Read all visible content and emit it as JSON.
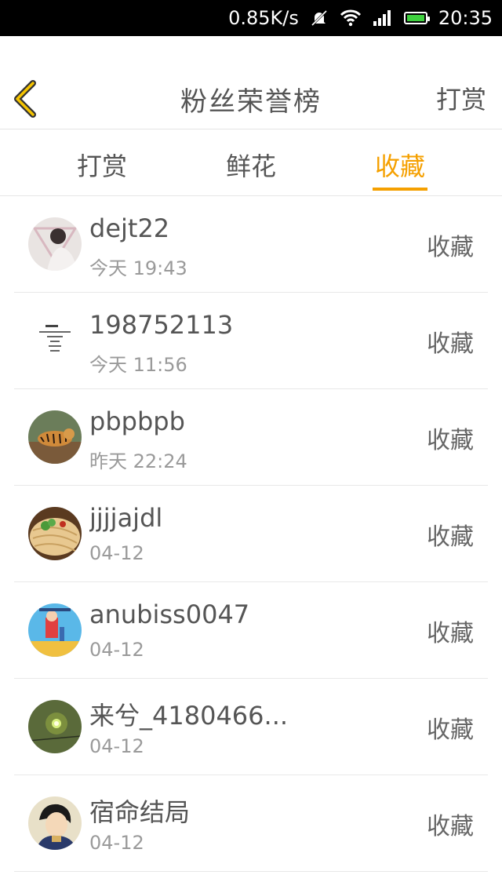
{
  "status_bar": {
    "net_speed": "0.85K/s",
    "time": "20:35",
    "icons": [
      "bell-muted-icon",
      "wifi-icon",
      "signal-icon",
      "battery-icon"
    ]
  },
  "header": {
    "title": "粉丝荣誉榜",
    "action_label": "打赏",
    "back_icon": "chevron-left-icon"
  },
  "tabs": [
    {
      "label": "打赏",
      "active": false
    },
    {
      "label": "鲜花",
      "active": false
    },
    {
      "label": "收藏",
      "active": true
    }
  ],
  "colors": {
    "accent": "#f5a000",
    "text": "#555555",
    "subtext": "#9a9a9a",
    "divider": "#e8e8e8"
  },
  "fans": [
    {
      "name": "dejt22",
      "time": "今天 19:43",
      "action": "收藏",
      "avatar": "avatar-portrait"
    },
    {
      "name": "198752113",
      "time": "今天 11:56",
      "action": "收藏",
      "avatar": "avatar-text-note"
    },
    {
      "name": "pbpbpb",
      "time": "昨天 22:24",
      "action": "收藏",
      "avatar": "avatar-tiger"
    },
    {
      "name": "jjjjajdl",
      "time": "04-12",
      "action": "收藏",
      "avatar": "avatar-noodles"
    },
    {
      "name": "anubiss0047",
      "time": "04-12",
      "action": "收藏",
      "avatar": "avatar-cartoon"
    },
    {
      "name": "来兮_4180466...",
      "time": "04-12",
      "action": "收藏",
      "avatar": "avatar-green-light"
    },
    {
      "name": "宿命结局",
      "time": "04-12",
      "action": "收藏",
      "avatar": "avatar-anime"
    }
  ]
}
